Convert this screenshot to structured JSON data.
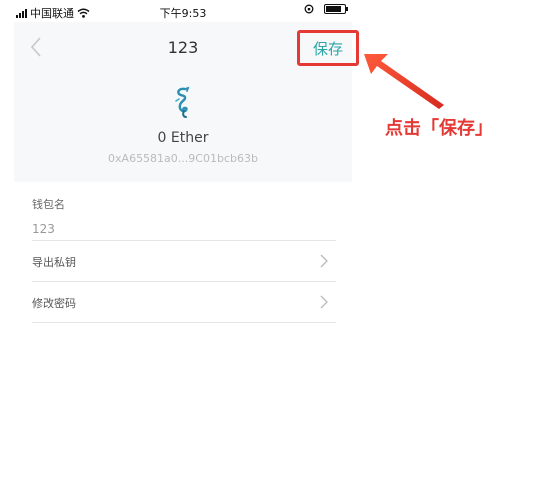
{
  "status_bar": {
    "carrier": "中国联通",
    "time": "下午9:53",
    "battery_level": 0.85
  },
  "header": {
    "title": "123",
    "save_label": "保存",
    "balance": "0 Ether",
    "address": "0xA65581a0...9C01bcb63b"
  },
  "wallet_name": {
    "label": "钱包名",
    "value": "123"
  },
  "menu": [
    {
      "label": "导出私钥",
      "icon": "chevron-right-icon"
    },
    {
      "label": "修改密码",
      "icon": "chevron-right-icon"
    }
  ],
  "annotation": {
    "callout": "点击「保存」",
    "color": "#e53935"
  },
  "colors": {
    "accent": "#2aa5a8",
    "header_bg": "#f6f8fa",
    "highlight": "#e53935"
  }
}
